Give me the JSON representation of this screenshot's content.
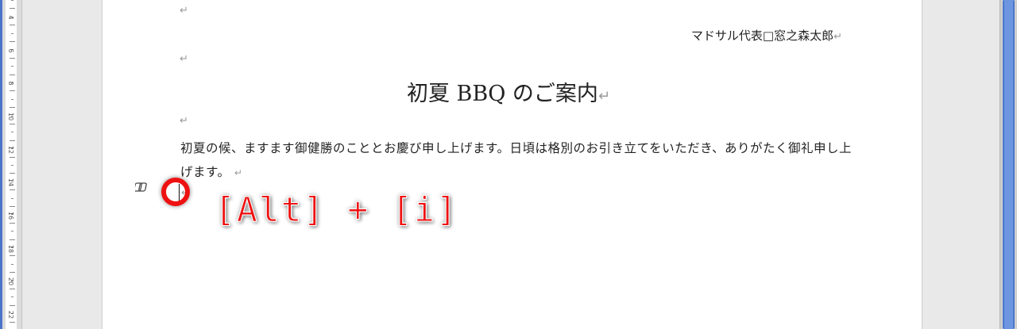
{
  "document": {
    "signature": "マドサル代表□窓之森太郎",
    "title": "初夏 BBQ のご案内",
    "body": "初夏の候、ますます御健勝のこととお慶び申し上げます。日頃は格別のお引き立てをいただき、ありがたく御礼申し上げます。",
    "paragraph_mark": "↵"
  },
  "annotation": {
    "shortcut": "[Alt] + [i]",
    "accent_color": "#ee1111"
  },
  "ruler": {
    "numbers": [
      "4",
      "6",
      "8",
      "10",
      "12",
      "14",
      "16",
      "18",
      "20",
      "22"
    ]
  }
}
